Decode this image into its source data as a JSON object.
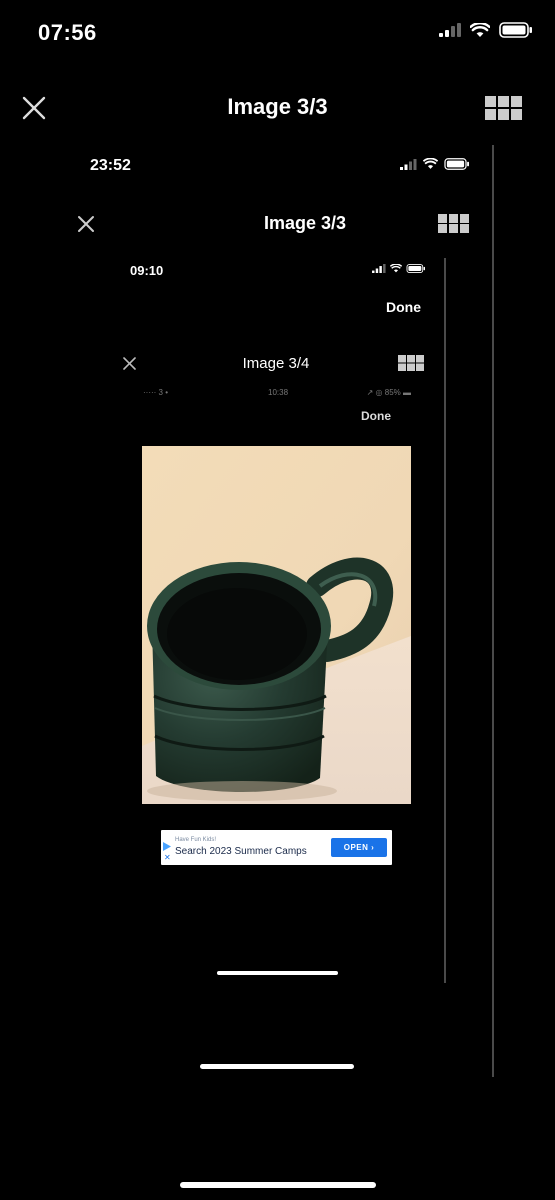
{
  "level1": {
    "status_time": "07:56",
    "title": "Image 3/3",
    "icons": {
      "close": "close-icon",
      "grid": "grid-icon",
      "signal": "signal-icon",
      "wifi": "wifi-icon",
      "battery": "battery-icon"
    }
  },
  "level2": {
    "status_time": "23:52",
    "title": "Image 3/3"
  },
  "level3": {
    "status_time": "09:10",
    "done": "Done",
    "title": "Image 3/4"
  },
  "level4": {
    "status_left": "····· 3 •",
    "status_time": "10:38",
    "status_right": "↗ ◎ 85% ▬",
    "done": "Done"
  },
  "photo": {
    "subject": "green-mug"
  },
  "ad": {
    "small_text": "Have Fun Kids!",
    "main_text": "Search 2023 Summer Camps",
    "button": "OPEN ›"
  },
  "colors": {
    "background": "#000000",
    "divider": "#4a4a4a",
    "ad_button": "#1a73e8"
  }
}
